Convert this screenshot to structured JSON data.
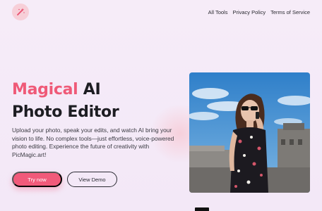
{
  "header": {
    "logo_icon": "magic-wand-icon",
    "nav": [
      {
        "label": "All Tools"
      },
      {
        "label": "Privacy Policy"
      },
      {
        "label": "Terms of Service"
      }
    ]
  },
  "hero": {
    "title_accent": "Magical",
    "title_rest_line1": " AI",
    "title_line2": "Photo Editor",
    "description": "Upload your photo, speak your edits, and watch AI bring your vision to life. No complex tools—just effortless, voice-powered photo editing. Experience the future of creativity with PicMagic.art!",
    "primary_button": "Try now",
    "secondary_button": "View Demo",
    "image_icon": "hero-photo"
  },
  "colors": {
    "accent": "#ef5a78",
    "background": "#f5eaf7",
    "logo_bg": "#f7cfd8"
  }
}
